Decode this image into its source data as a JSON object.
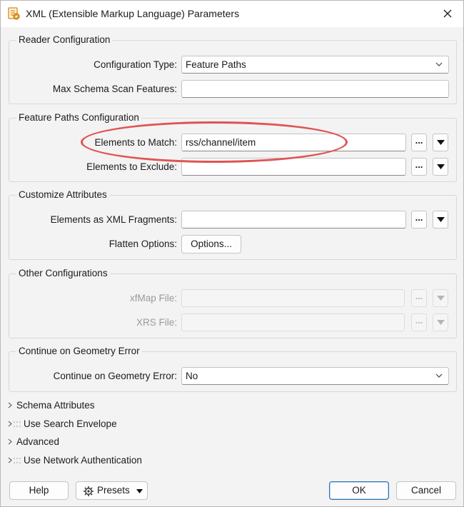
{
  "window": {
    "title": "XML (Extensible Markup Language) Parameters",
    "app_icon": "fme-reader-icon",
    "close_icon": "close-icon"
  },
  "reader_config": {
    "title": "Reader Configuration",
    "config_type_label": "Configuration Type:",
    "config_type_value": "Feature Paths",
    "max_scan_label": "Max Schema Scan Features:",
    "max_scan_value": ""
  },
  "feature_paths": {
    "title": "Feature Paths Configuration",
    "match_label": "Elements to Match:",
    "match_value": "rss/channel/item",
    "exclude_label": "Elements to Exclude:",
    "exclude_value": "",
    "ellipsis": "..."
  },
  "customize": {
    "title": "Customize Attributes",
    "fragments_label": "Elements as XML Fragments:",
    "fragments_value": "",
    "flatten_label": "Flatten Options:",
    "options_button": "Options..."
  },
  "other": {
    "title": "Other Configurations",
    "xfmap_label": "xfMap File:",
    "xfmap_value": "",
    "xrs_label": "XRS File:",
    "xrs_value": ""
  },
  "geometry_error": {
    "title": "Continue on Geometry Error",
    "label": "Continue on Geometry Error:",
    "value": "No"
  },
  "collapsed_sections": [
    {
      "label": "Schema Attributes"
    },
    {
      "label": "Use Search Envelope"
    },
    {
      "label": "Advanced"
    },
    {
      "label": "Use Network Authentication"
    }
  ],
  "footer": {
    "help": "Help",
    "presets": "Presets",
    "ok": "OK",
    "cancel": "Cancel"
  },
  "colors": {
    "annotation": "#e05353",
    "primary_border": "#2f6fb5"
  }
}
